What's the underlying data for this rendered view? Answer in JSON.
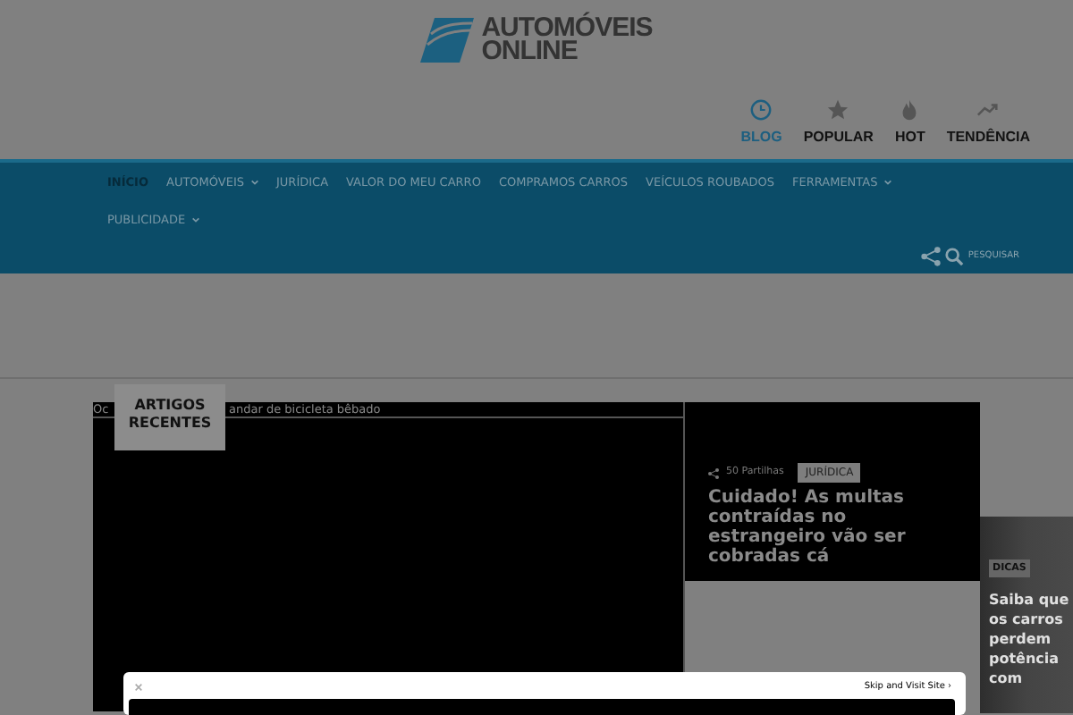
{
  "logo": {
    "line1": "AUTOMÓVEIS",
    "line2": "ONLINE"
  },
  "tabs": [
    {
      "label": "BLOG",
      "selected": true
    },
    {
      "label": "POPULAR",
      "selected": false
    },
    {
      "label": "HOT",
      "selected": false
    },
    {
      "label": "TENDÊNCIA",
      "selected": false
    }
  ],
  "nav": {
    "items": [
      {
        "label": "INÍCIO",
        "selected": true,
        "dropdown": false
      },
      {
        "label": "AUTOMÓVEIS",
        "selected": false,
        "dropdown": true
      },
      {
        "label": "JURÍDICA",
        "selected": false,
        "dropdown": false
      },
      {
        "label": "VALOR DO MEU CARRO",
        "selected": false,
        "dropdown": false
      },
      {
        "label": "COMPRAMOS CARROS",
        "selected": false,
        "dropdown": false
      },
      {
        "label": "VEÍCULOS ROUBADOS",
        "selected": false,
        "dropdown": false
      },
      {
        "label": "FERRAMENTAS",
        "selected": false,
        "dropdown": true
      },
      {
        "label": "PUBLICIDADE",
        "selected": false,
        "dropdown": true
      }
    ],
    "search_label": "PESQUISAR"
  },
  "ticker": {
    "badge": "ARTIGOS RECENTES",
    "text_start": "Oc",
    "text_end": "andar de bicicleta bêbado"
  },
  "featured": {
    "shares": "50 Partilhas",
    "category": "JURÍDICA",
    "title": "Cuidado! As multas contraídas no estrangeiro vão ser cobradas cá"
  },
  "side_post": {
    "category": "DICAS",
    "title": "Saiba que os carros perdem potência com"
  },
  "ad": {
    "skip_label": "Skip and Visit Site ›"
  }
}
